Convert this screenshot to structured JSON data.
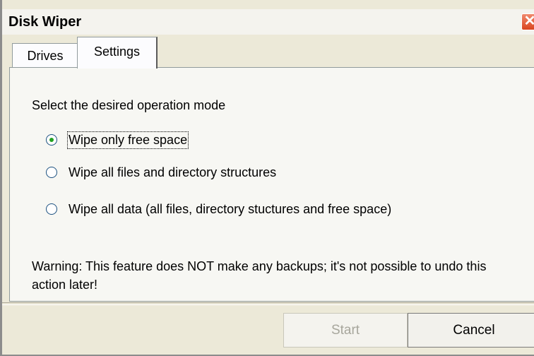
{
  "window": {
    "title": "Disk Wiper",
    "close_glyph": "✕"
  },
  "tabs": [
    {
      "label": "Drives",
      "selected": false
    },
    {
      "label": "Settings",
      "selected": true
    }
  ],
  "settings": {
    "prompt": "Select the desired operation mode",
    "options": [
      {
        "label": "Wipe only free space",
        "checked": true
      },
      {
        "label": "Wipe all files and directory structures",
        "checked": false
      },
      {
        "label": "Wipe all data (all files, directory stuctures and free space)",
        "checked": false
      }
    ],
    "warning": "Warning: This feature does NOT make any backups; it's not possible to undo this action later!"
  },
  "buttons": {
    "start": "Start",
    "start_enabled": false,
    "cancel": "Cancel"
  },
  "colors": {
    "close_button": "#d9441f",
    "radio_dot": "#21a121"
  }
}
